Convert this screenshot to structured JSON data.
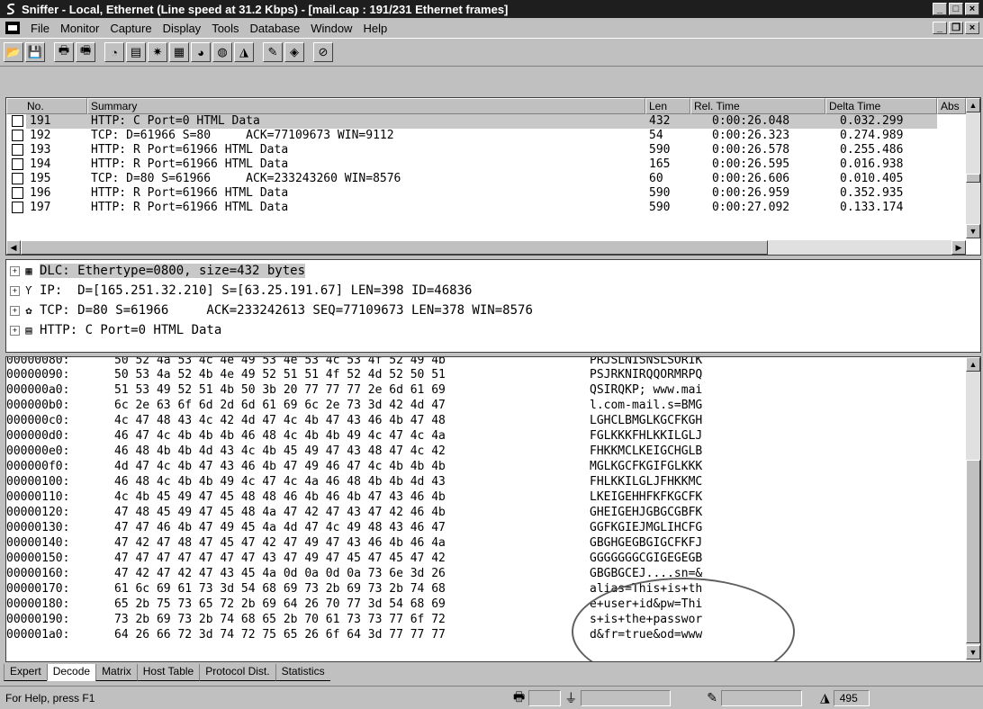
{
  "window": {
    "title": "Sniffer - Local, Ethernet (Line speed at 31.2 Kbps) - [mail.cap : 191/231 Ethernet frames]",
    "controls": {
      "minimize": "_",
      "maximize": "□",
      "close": "×"
    }
  },
  "menu": {
    "items": [
      {
        "label": "File"
      },
      {
        "label": "Monitor"
      },
      {
        "label": "Capture"
      },
      {
        "label": "Display"
      },
      {
        "label": "Tools"
      },
      {
        "label": "Database"
      },
      {
        "label": "Window"
      },
      {
        "label": "Help"
      }
    ],
    "mdi_controls": {
      "minimize": "_",
      "restore": "❐",
      "close": "×"
    }
  },
  "toolbar": {
    "buttons": [
      {
        "icon": "open-folder-icon",
        "glyph": "📂"
      },
      {
        "icon": "save-icon",
        "glyph": "💾"
      },
      {
        "icon": "print-icon",
        "glyph": "🖶"
      },
      {
        "icon": "print-preview-icon",
        "glyph": "🖷"
      },
      {
        "icon": "dashboard-icon",
        "glyph": "◔"
      },
      {
        "icon": "host-table-icon",
        "glyph": "▤"
      },
      {
        "icon": "matrix-icon",
        "glyph": "✷"
      },
      {
        "icon": "history-icon",
        "glyph": "▦"
      },
      {
        "icon": "protocol-dist-icon",
        "glyph": "◕"
      },
      {
        "icon": "global-stats-icon",
        "glyph": "◍"
      },
      {
        "icon": "alarm-log-icon",
        "glyph": "◮"
      },
      {
        "icon": "define-filter-icon",
        "glyph": "✎"
      },
      {
        "icon": "select-filter-icon",
        "glyph": "◈"
      },
      {
        "icon": "stop-icon",
        "glyph": "⊘"
      }
    ]
  },
  "packet_list": {
    "columns": [
      "No.",
      "Summary",
      "Len",
      "Rel. Time",
      "Delta Time",
      "Abs"
    ],
    "rows": [
      {
        "no": "191",
        "summary": "HTTP: C Port=0 HTML Data",
        "len": "432",
        "rel": "0:00:26.048",
        "delta": "0.032.299",
        "selected": true
      },
      {
        "no": "192",
        "summary": "TCP: D=61966 S=80     ACK=77109673 WIN=9112",
        "len": "54",
        "rel": "0:00:26.323",
        "delta": "0.274.989"
      },
      {
        "no": "193",
        "summary": "HTTP: R Port=61966 HTML Data",
        "len": "590",
        "rel": "0:00:26.578",
        "delta": "0.255.486"
      },
      {
        "no": "194",
        "summary": "HTTP: R Port=61966 HTML Data",
        "len": "165",
        "rel": "0:00:26.595",
        "delta": "0.016.938"
      },
      {
        "no": "195",
        "summary": "TCP: D=80 S=61966     ACK=233243260 WIN=8576",
        "len": "60",
        "rel": "0:00:26.606",
        "delta": "0.010.405"
      },
      {
        "no": "196",
        "summary": "HTTP: R Port=61966 HTML Data",
        "len": "590",
        "rel": "0:00:26.959",
        "delta": "0.352.935"
      },
      {
        "no": "197",
        "summary": "HTTP: R Port=61966 HTML Data",
        "len": "590",
        "rel": "0:00:27.092",
        "delta": "0.133.174"
      }
    ]
  },
  "decode": {
    "lines": [
      {
        "icon": "dlc-icon",
        "glyph": "▦",
        "text": "DLC: Ethertype=0800, size=432 bytes",
        "highlight": true
      },
      {
        "icon": "ip-icon",
        "glyph": "Ƴ",
        "text": "IP:  D=[165.251.32.210] S=[63.25.191.67] LEN=398 ID=46836"
      },
      {
        "icon": "tcp-icon",
        "glyph": "✿",
        "text": "TCP: D=80 S=61966     ACK=233242613 SEQ=77109673 LEN=378 WIN=8576"
      },
      {
        "icon": "http-icon",
        "glyph": "▤",
        "text": "HTTP: C Port=0 HTML Data"
      }
    ]
  },
  "hex": {
    "rows": [
      {
        "off": "00000080:",
        "bytes": "50 52 4a 53 4c 4e 49 53 4e 53 4c 53 4f 52 49 4b",
        "ascii": "PRJSLNISNSLSORIK"
      },
      {
        "off": "00000090:",
        "bytes": "50 53 4a 52 4b 4e 49 52 51 51 4f 52 4d 52 50 51",
        "ascii": "PSJRKNIRQQORMRPQ"
      },
      {
        "off": "000000a0:",
        "bytes": "51 53 49 52 51 4b 50 3b 20 77 77 77 2e 6d 61 69",
        "ascii": "QSIRQKP; www.mai"
      },
      {
        "off": "000000b0:",
        "bytes": "6c 2e 63 6f 6d 2d 6d 61 69 6c 2e 73 3d 42 4d 47",
        "ascii": "l.com-mail.s=BMG"
      },
      {
        "off": "000000c0:",
        "bytes": "4c 47 48 43 4c 42 4d 47 4c 4b 47 43 46 4b 47 48",
        "ascii": "LGHCLBMGLKGCFKGH"
      },
      {
        "off": "000000d0:",
        "bytes": "46 47 4c 4b 4b 4b 46 48 4c 4b 4b 49 4c 47 4c 4a",
        "ascii": "FGLKKKFHLKKILGLJ"
      },
      {
        "off": "000000e0:",
        "bytes": "46 48 4b 4b 4d 43 4c 4b 45 49 47 43 48 47 4c 42",
        "ascii": "FHKKMCLKEIGCHGLB"
      },
      {
        "off": "000000f0:",
        "bytes": "4d 47 4c 4b 47 43 46 4b 47 49 46 47 4c 4b 4b 4b",
        "ascii": "MGLKGCFKGIFGLKKK"
      },
      {
        "off": "00000100:",
        "bytes": "46 48 4c 4b 4b 49 4c 47 4c 4a 46 48 4b 4b 4d 43",
        "ascii": "FHLKKILGLJFHKKMC"
      },
      {
        "off": "00000110:",
        "bytes": "4c 4b 45 49 47 45 48 48 46 4b 46 4b 47 43 46 4b",
        "ascii": "LKEIGEHHFKFKGCFK"
      },
      {
        "off": "00000120:",
        "bytes": "47 48 45 49 47 45 48 4a 47 42 47 43 47 42 46 4b",
        "ascii": "GHEIGEHJGBGCGBFK"
      },
      {
        "off": "00000130:",
        "bytes": "47 47 46 4b 47 49 45 4a 4d 47 4c 49 48 43 46 47",
        "ascii": "GGFKGIEJMGLIHCFG"
      },
      {
        "off": "00000140:",
        "bytes": "47 42 47 48 47 45 47 42 47 49 47 43 46 4b 46 4a",
        "ascii": "GBGHGEGBGIGCFKFJ"
      },
      {
        "off": "00000150:",
        "bytes": "47 47 47 47 47 47 47 43 47 49 47 45 47 45 47 42",
        "ascii": "GGGGGGGCGIGEGEGB"
      },
      {
        "off": "00000160:",
        "bytes": "47 42 47 42 47 43 45 4a 0d 0a 0d 0a 73 6e 3d 26",
        "ascii": "GBGBGCEJ....sn=&"
      },
      {
        "off": "00000170:",
        "bytes": "61 6c 69 61 73 3d 54 68 69 73 2b 69 73 2b 74 68",
        "ascii": "alias=This+is+th"
      },
      {
        "off": "00000180:",
        "bytes": "65 2b 75 73 65 72 2b 69 64 26 70 77 3d 54 68 69",
        "ascii": "e+user+id&pw=Thi"
      },
      {
        "off": "00000190:",
        "bytes": "73 2b 69 73 2b 74 68 65 2b 70 61 73 73 77 6f 72",
        "ascii": "s+is+the+passwor"
      },
      {
        "off": "000001a0:",
        "bytes": "64 26 66 72 3d 74 72 75 65 26 6f 64 3d 77 77 77",
        "ascii": "d&fr=true&od=www"
      }
    ]
  },
  "tabs": [
    {
      "label": "Expert"
    },
    {
      "label": "Decode",
      "active": true
    },
    {
      "label": "Matrix"
    },
    {
      "label": "Host Table"
    },
    {
      "label": "Protocol Dist."
    },
    {
      "label": "Statistics"
    }
  ],
  "status": {
    "help": "For Help, press F1",
    "frame_count": "495"
  }
}
